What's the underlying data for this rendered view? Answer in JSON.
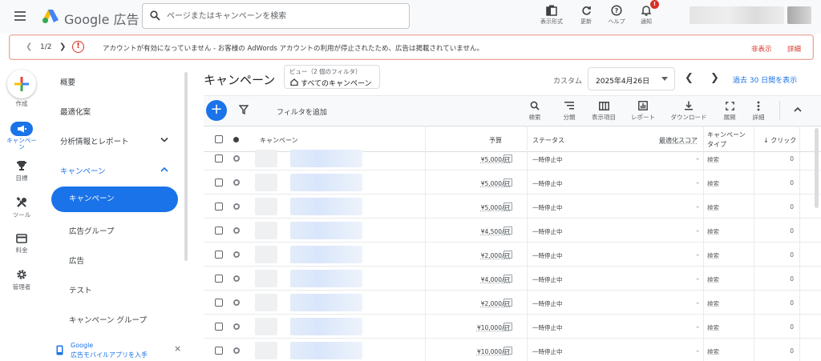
{
  "topbar": {
    "brand": "Google 広告",
    "search_placeholder": "ページまたはキャンペーンを検索",
    "tools": [
      {
        "label": "表示形式",
        "icon": "appearance-icon"
      },
      {
        "label": "更新",
        "icon": "refresh-icon"
      },
      {
        "label": "ヘルプ",
        "icon": "help-icon"
      },
      {
        "label": "通知",
        "icon": "bell-icon"
      }
    ],
    "notification_badge": "!"
  },
  "alert": {
    "counter": "1/2",
    "message": "アカウントが有効になっていません - お客様の AdWords アカウントの利用が停止されたため、広告は掲載されていません。",
    "hide_label": "非表示",
    "detail_label": "詳細"
  },
  "rail": [
    {
      "label": "作成",
      "icon": "plus-icon"
    },
    {
      "label": "キャンペーン",
      "icon": "megaphone-icon"
    },
    {
      "label": "目標",
      "icon": "trophy-icon"
    },
    {
      "label": "ツール",
      "icon": "tools-icon"
    },
    {
      "label": "料金",
      "icon": "credit-card-icon"
    },
    {
      "label": "管理者",
      "icon": "gear-icon"
    }
  ],
  "sidenav": {
    "overview": "概要",
    "optimization": "最適化案",
    "reports": "分析情報とレポート",
    "campaigns_group": "キャンペーン",
    "sub_items": [
      "キャンペーン",
      "広告グループ",
      "広告",
      "テスト",
      "キャンペーン グループ"
    ],
    "active_item": "キャンペーン",
    "promo_line1": "Google",
    "promo_line2": "広告モバイルアプリを入手",
    "promo_close": "×"
  },
  "main": {
    "title": "キャンペーン",
    "view_label": "ビュー（2 個のフィルタ）",
    "view_value": "すべてのキャンペーン",
    "custom_label": "カスタム",
    "date_value": "2025年4月26日",
    "range_link": "過去 30 日間を表示"
  },
  "toolbar": {
    "filter_add": "フィルタを追加",
    "tools": [
      {
        "label": "検索",
        "icon": "search-icon"
      },
      {
        "label": "分類",
        "icon": "segment-icon"
      },
      {
        "label": "表示項目",
        "icon": "columns-icon"
      },
      {
        "label": "レポート",
        "icon": "report-icon"
      },
      {
        "label": "ダウンロード",
        "icon": "download-icon"
      },
      {
        "label": "展開",
        "icon": "expand-icon"
      },
      {
        "label": "詳細",
        "icon": "more-vert-icon"
      }
    ]
  },
  "table": {
    "headers": {
      "campaign": "キャンペーン",
      "budget": "予算",
      "status": "ステータス",
      "optimization_score": "最適化スコア",
      "campaign_type_line1": "キャンペーン",
      "campaign_type_line2": "タイプ",
      "clicks": "↓ クリック"
    },
    "rows": [
      {
        "budget": "¥5,000/日",
        "status": "一時停止中",
        "opt": "–",
        "type": "検索",
        "clicks": "0"
      },
      {
        "budget": "¥5,000/日",
        "status": "一時停止中",
        "opt": "–",
        "type": "検索",
        "clicks": "0"
      },
      {
        "budget": "¥5,000/日",
        "status": "一時停止中",
        "opt": "–",
        "type": "検索",
        "clicks": "0"
      },
      {
        "budget": "¥4,500/日",
        "status": "一時停止中",
        "opt": "–",
        "type": "検索",
        "clicks": "0"
      },
      {
        "budget": "¥2,000/日",
        "status": "一時停止中",
        "opt": "–",
        "type": "検索",
        "clicks": "0"
      },
      {
        "budget": "¥4,000/日",
        "status": "一時停止中",
        "opt": "–",
        "type": "検索",
        "clicks": "0"
      },
      {
        "budget": "¥2,000/日",
        "status": "一時停止中",
        "opt": "–",
        "type": "検索",
        "clicks": "0"
      },
      {
        "budget": "¥10,000/日",
        "status": "一時停止中",
        "opt": "–",
        "type": "検索",
        "clicks": "0"
      },
      {
        "budget": "¥10,000/日",
        "status": "一時停止中",
        "opt": "–",
        "type": "検索",
        "clicks": "0"
      }
    ]
  },
  "colors": {
    "accent": "#1a73e8",
    "error": "#d93025",
    "alert_border": "#e8a89c"
  }
}
